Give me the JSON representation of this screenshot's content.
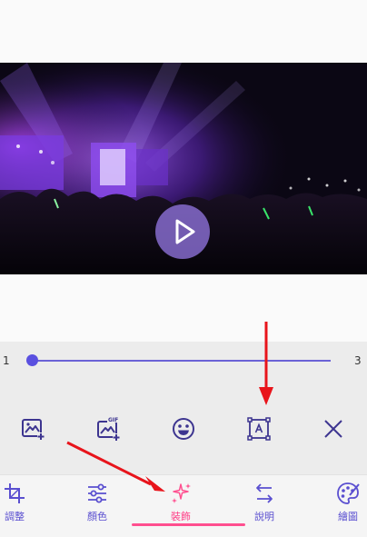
{
  "slider": {
    "min_label": "1",
    "max_label": "3",
    "value": 1
  },
  "decoration_toolbar": {
    "buttons": [
      "add-image-icon",
      "add-gif-icon",
      "emoji-icon",
      "text-box-icon",
      "close-icon"
    ]
  },
  "tabs": [
    {
      "label": "調整",
      "icon": "crop-icon",
      "active": false
    },
    {
      "label": "顏色",
      "icon": "sliders-icon",
      "active": false
    },
    {
      "label": "裝飾",
      "icon": "sparkle-icon",
      "active": true
    },
    {
      "label": "說明",
      "icon": "swap-arrows-icon",
      "active": false
    },
    {
      "label": "繪圖",
      "icon": "palette-icon",
      "active": false
    }
  ],
  "colors": {
    "accent": "#5a50e0",
    "active_tab": "#ff3e87",
    "arrow": "#e8141b"
  }
}
